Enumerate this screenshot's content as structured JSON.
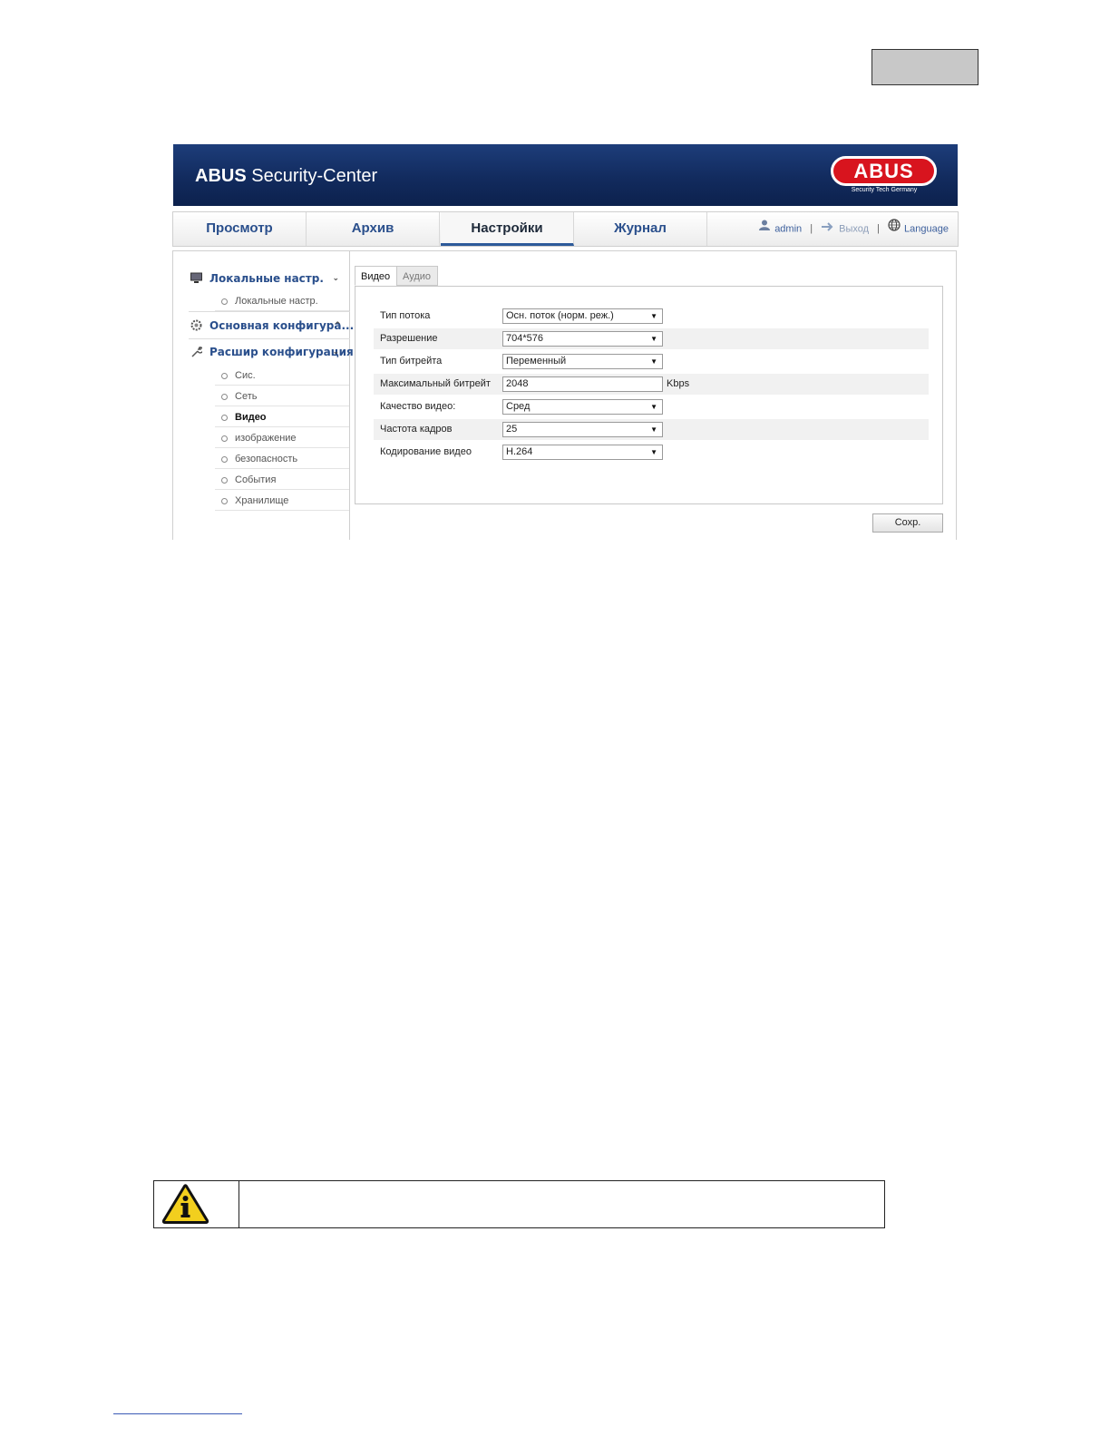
{
  "app": {
    "brand_bold": "ABUS",
    "brand_rest": " Security-Center",
    "logo_text": "ABUS",
    "logo_sub": "Security Tech Germany"
  },
  "nav": {
    "tabs": [
      {
        "label": "Просмотр",
        "active": false
      },
      {
        "label": "Архив",
        "active": false
      },
      {
        "label": "Настройки",
        "active": true
      },
      {
        "label": "Журнал",
        "active": false
      }
    ],
    "user": "admin",
    "logout": "Выход",
    "language": "Language"
  },
  "sidebar": {
    "sections": [
      {
        "label": "Локальные настр.",
        "icon": "monitor-icon",
        "chevron": "⌄"
      },
      {
        "label": "Основная конфигура...",
        "icon": "gear-icon",
        "chevron": "^"
      },
      {
        "label": "Расшир конфигурация",
        "icon": "wrench-icon",
        "chevron": "⌄"
      }
    ],
    "local_items": [
      "Локальные настр."
    ],
    "advanced_items": [
      {
        "label": "Сис.",
        "active": false
      },
      {
        "label": "Сеть",
        "active": false
      },
      {
        "label": "Видео",
        "active": true
      },
      {
        "label": "изображение",
        "active": false
      },
      {
        "label": "безопасность",
        "active": false
      },
      {
        "label": "События",
        "active": false
      },
      {
        "label": "Хранилище",
        "active": false
      }
    ]
  },
  "tabs": {
    "video": "Видео",
    "audio": "Аудио",
    "active": "video"
  },
  "form": {
    "rows": [
      {
        "label": "Тип потока",
        "value": "Осн. поток (норм. реж.)",
        "kind": "select"
      },
      {
        "label": "Разрешение",
        "value": "704*576",
        "kind": "select"
      },
      {
        "label": "Тип битрейта",
        "value": "Переменный",
        "kind": "select"
      },
      {
        "label": "Максимальный битрейт",
        "value": "2048",
        "kind": "input",
        "unit": "Kbps"
      },
      {
        "label": "Качество видео:",
        "value": "Сред",
        "kind": "select"
      },
      {
        "label": "Частота кадров",
        "value": "25",
        "kind": "select"
      },
      {
        "label": "Кодирование видео",
        "value": "H.264",
        "kind": "select"
      }
    ],
    "save_label": "Сохр."
  },
  "colors": {
    "banner": "#122b5e",
    "nav_text": "#2a4f8c",
    "logo_red": "#d8141e"
  }
}
